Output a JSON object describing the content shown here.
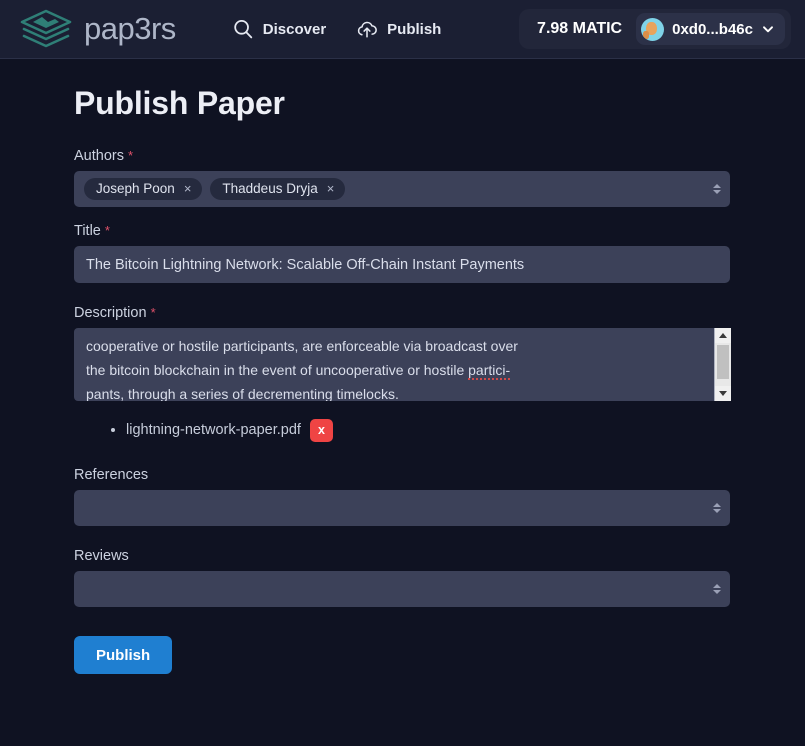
{
  "header": {
    "brand_name": "pap3rs",
    "logo_icon": "layers-logo-icon",
    "nav": [
      {
        "label": "Discover",
        "icon": "search-icon"
      },
      {
        "label": "Publish",
        "icon": "cloud-upload-icon"
      }
    ],
    "wallet": {
      "balance": "7.98 MATIC",
      "address": "0xd0...b46c",
      "avatar_icon": "wallet-avatar-identicon",
      "chevron_icon": "chevron-down-icon"
    }
  },
  "page": {
    "title": "Publish Paper"
  },
  "form": {
    "authors": {
      "label": "Authors",
      "required_marker": "*",
      "tags": [
        {
          "name": "Joseph Poon",
          "remove": "×"
        },
        {
          "name": "Thaddeus Dryja",
          "remove": "×"
        }
      ]
    },
    "title": {
      "label": "Title",
      "required_marker": "*",
      "value": "The Bitcoin Lightning Network: Scalable Off-Chain Instant Payments",
      "placeholder": ""
    },
    "description": {
      "label": "Description",
      "required_marker": "*",
      "line1": "cooperative or hostile participants, are enforceable via broadcast over",
      "line2a": "the bitcoin blockchain in the event of uncooperative or hostile ",
      "line2b": "partici-",
      "line3a": "pants, through a series of decrementing ",
      "line3b": "timelocks",
      "line3c": "."
    },
    "files": [
      {
        "name": "lightning-network-paper.pdf",
        "remove_label": "x"
      }
    ],
    "references": {
      "label": "References",
      "value": "",
      "placeholder": ""
    },
    "reviews": {
      "label": "Reviews",
      "value": "",
      "placeholder": ""
    },
    "submit_label": "Publish"
  },
  "colors": {
    "accent_blue": "#1f7fd1",
    "brand_teal": "#2f7f77",
    "danger_red": "#ef4444",
    "required_red": "#e0526a",
    "page_bg": "#0f1222",
    "header_bg": "#1b1f33",
    "input_bg": "#3c4159"
  }
}
